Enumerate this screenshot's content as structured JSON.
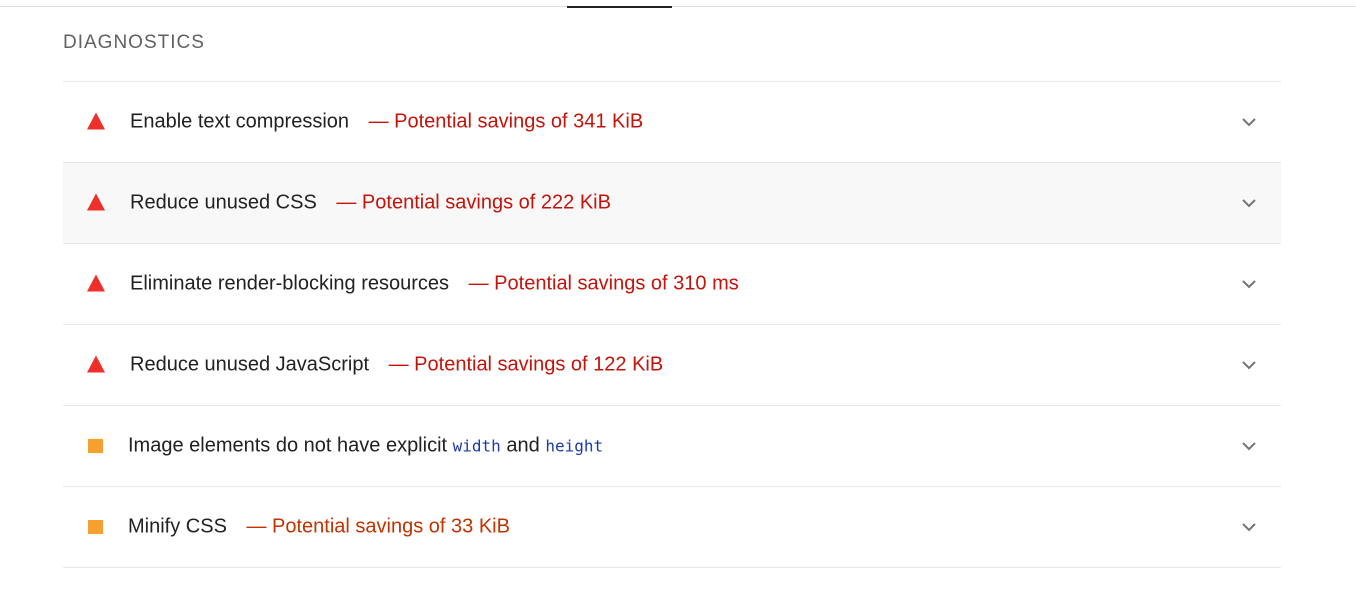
{
  "section": {
    "title": "Diagnostics"
  },
  "audits": [
    {
      "title": "Enable text compression",
      "separator": "—",
      "savings": "Potential savings of 341 KiB",
      "severity": "fail",
      "severity_icon": "red-triangle-icon"
    },
    {
      "title": "Reduce unused CSS",
      "separator": "—",
      "savings": "Potential savings of 222 KiB",
      "severity": "fail",
      "severity_icon": "red-triangle-icon",
      "hovered": true
    },
    {
      "title": "Eliminate render-blocking resources",
      "separator": "—",
      "savings": "Potential savings of 310 ms",
      "severity": "fail",
      "severity_icon": "red-triangle-icon"
    },
    {
      "title": "Reduce unused JavaScript",
      "separator": "—",
      "savings": "Potential savings of 122 KiB",
      "severity": "fail",
      "severity_icon": "red-triangle-icon"
    },
    {
      "title_prefix": "Image elements do not have explicit",
      "code1": "width",
      "joiner": "and",
      "code2": "height",
      "severity": "average",
      "severity_icon": "orange-square-icon"
    },
    {
      "title": "Minify CSS",
      "separator": "—",
      "savings": "Potential savings of 33 KiB",
      "severity": "average",
      "severity_icon": "orange-square-icon"
    }
  ],
  "colors": {
    "fail": "#ee2f2a",
    "fail_text": "#c5130a",
    "average": "#f7a02f",
    "average_text": "#c33300",
    "code": "#1a3ba9"
  },
  "icons": {
    "expand": "chevron-down-icon"
  }
}
